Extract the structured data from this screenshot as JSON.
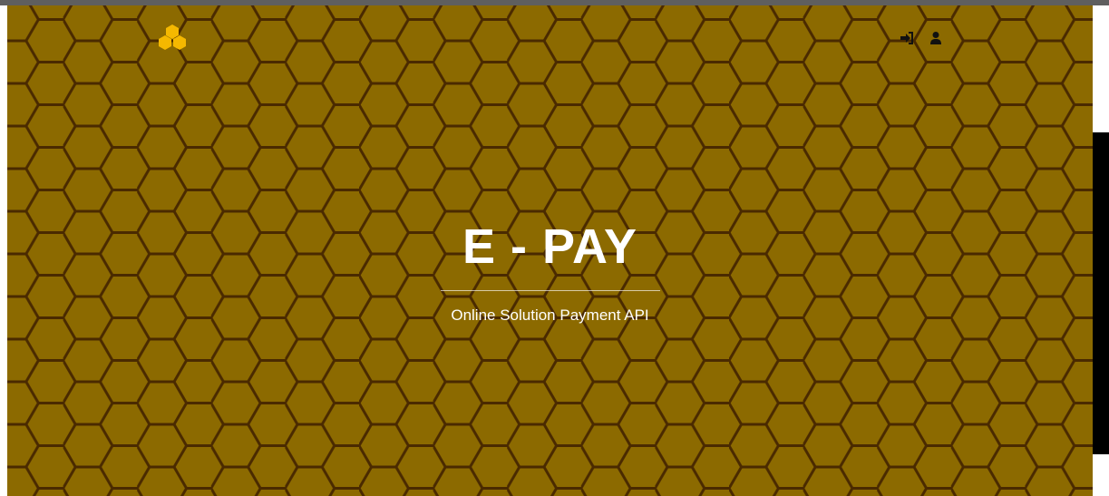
{
  "colors": {
    "background": "#8c6a00",
    "honeycomb_lines": "#4a2a00",
    "logo": "#f5b800",
    "text": "#ffffff",
    "nav_icons": "#111111"
  },
  "navbar": {
    "logo_icon": "honeycomb-logo-icon",
    "icons": [
      "sign-in-icon",
      "user-icon"
    ]
  },
  "hero": {
    "title": "E - PAY",
    "subtitle": "Online Solution Payment API"
  }
}
